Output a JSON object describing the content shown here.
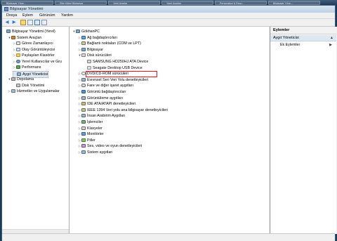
{
  "taskbar": {
    "buttons": [
      "Bilgisayar Yöne...",
      "Zibe Kitleri Bilgisayar",
      "Yerel Ayarlar",
      "Yerel Aygıtlar",
      "Personalize & Reco...",
      "Bilgisayar Yöne..."
    ]
  },
  "window": {
    "title": "Bilgisayar Yönetimi"
  },
  "menu": [
    "Dosya",
    "Eylem",
    "Görünüm",
    "Yardım"
  ],
  "toolbar": {
    "icons": [
      "back-arrow-icon",
      "forward-arrow-icon",
      "up-folder-icon",
      "properties-icon",
      "help-icon",
      "show-hide-tree-icon"
    ]
  },
  "left_tree": [
    {
      "label": "Bilgisayar Yönetimi (Yerel)",
      "icon": "computer-icon",
      "level": 0,
      "expander": ""
    },
    {
      "label": "Sistem Araçları",
      "icon": "tools-icon",
      "level": 1,
      "expander": "▼"
    },
    {
      "label": "Görev Zamanlayıcı",
      "icon": "calendar-icon",
      "level": 2,
      "expander": "▷"
    },
    {
      "label": "Olay Görüntüleyicisi",
      "icon": "event-log-icon",
      "level": 2,
      "expander": "▷"
    },
    {
      "label": "Paylaşılan Klasörler",
      "icon": "shared-folder-icon",
      "level": 2,
      "expander": "▷"
    },
    {
      "label": "Yerel Kullanıcılar ve Gru",
      "icon": "users-icon",
      "level": 2,
      "expander": "▷"
    },
    {
      "label": "Performans",
      "icon": "performance-icon",
      "level": 2,
      "expander": "▷"
    },
    {
      "label": "Aygıt Yöneticisi",
      "icon": "device-manager-icon",
      "level": 2,
      "expander": "",
      "selected": true
    },
    {
      "label": "Depolama",
      "icon": "storage-icon",
      "level": 1,
      "expander": "▼"
    },
    {
      "label": "Disk Yönetimi",
      "icon": "disk-icon",
      "level": 2,
      "expander": ""
    },
    {
      "label": "Hizmetler ve Uygulamalar",
      "icon": "services-icon",
      "level": 1,
      "expander": "▷"
    }
  ],
  "device_tree": [
    {
      "label": "GökhanPC",
      "icon": "computer-icon",
      "level": 0,
      "expander": "▼"
    },
    {
      "label": "Ağ bağdaştırıcıları",
      "icon": "network-adapter-icon",
      "level": 1,
      "expander": "▷"
    },
    {
      "label": "Bağlantı noktaları (COM ve LPT)",
      "icon": "port-icon",
      "level": 1,
      "expander": "▷"
    },
    {
      "label": "Bilgisayar",
      "icon": "computer-icon",
      "level": 1,
      "expander": "▷"
    },
    {
      "label": "Disk sürücüleri",
      "icon": "disk-drive-icon",
      "level": 1,
      "expander": "▼"
    },
    {
      "label": "SAMSUNG HD250HJ ATA Device",
      "icon": "disk-drive-icon",
      "level": 2,
      "expander": ""
    },
    {
      "label": "Seagate Desktop USB Device",
      "icon": "usb-drive-icon",
      "level": 2,
      "expander": "",
      "highlighted": true
    },
    {
      "label": "DVD/CD-ROM sürücüleri",
      "icon": "dvd-icon",
      "level": 1,
      "expander": "▷"
    },
    {
      "label": "Evrensel Seri Veri Yolu denetleyicileri",
      "icon": "usb-controller-icon",
      "level": 1,
      "expander": "▷"
    },
    {
      "label": "Fare ve diğer işaret aygıtları",
      "icon": "mouse-icon",
      "level": 1,
      "expander": "▷"
    },
    {
      "label": "Görüntü bağdaştırıcıları",
      "icon": "display-adapter-icon",
      "level": 1,
      "expander": "▷"
    },
    {
      "label": "Görüntüleme aygıtları",
      "icon": "imaging-device-icon",
      "level": 1,
      "expander": "▷"
    },
    {
      "label": "IDE ATA/ATAPI denetleyicileri",
      "icon": "ide-controller-icon",
      "level": 1,
      "expander": "▷"
    },
    {
      "label": "IEEE 1394 Veri yolu ana bilgisayar denetleyicileri",
      "icon": "ieee1394-icon",
      "level": 1,
      "expander": "▷"
    },
    {
      "label": "İnsan Arabirim Aygıtları",
      "icon": "hid-icon",
      "level": 1,
      "expander": "▷"
    },
    {
      "label": "İşlemciler",
      "icon": "processor-icon",
      "level": 1,
      "expander": "▷"
    },
    {
      "label": "Klavyeler",
      "icon": "keyboard-icon",
      "level": 1,
      "expander": "▷"
    },
    {
      "label": "Monitörler",
      "icon": "monitor-icon",
      "level": 1,
      "expander": "▷"
    },
    {
      "label": "Piller",
      "icon": "battery-icon",
      "level": 1,
      "expander": "▷"
    },
    {
      "label": "Ses, video ve oyun denetleyicileri",
      "icon": "sound-icon",
      "level": 1,
      "expander": "▷"
    },
    {
      "label": "Sistem aygıtları",
      "icon": "system-devices-icon",
      "level": 1,
      "expander": "▷"
    }
  ],
  "actions": {
    "header": "Eylemler",
    "section": "Aygıt Yöneticisi",
    "section_caret": "▲",
    "more_label": "Ek Eylemler",
    "more_caret": "▶"
  },
  "colors": {
    "highlight_border": "#e0161e",
    "selection_bg": "#dfe7f1",
    "titlebar": "#bcd0e5"
  }
}
